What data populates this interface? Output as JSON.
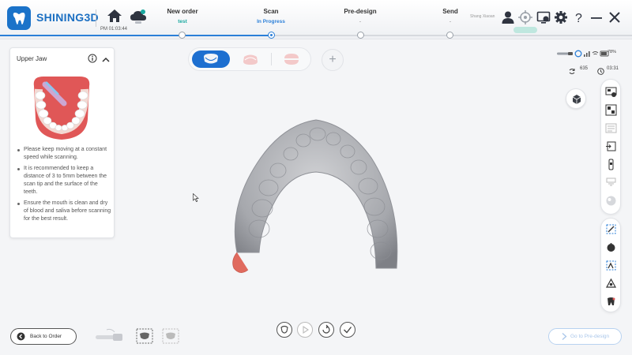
{
  "app": {
    "brand": "SHINING3D",
    "time": "PM 01:03:44",
    "user_name": "Shang Xiaoan",
    "accent": "#1d6fd0",
    "teal": "#1aa8a0"
  },
  "steps": [
    {
      "title": "New order",
      "sub": "test",
      "state": "done"
    },
    {
      "title": "Scan",
      "sub": "In Progress",
      "state": "active"
    },
    {
      "title": "Pre-design",
      "sub": "-",
      "state": "pending"
    },
    {
      "title": "Send",
      "sub": "-",
      "state": "pending"
    }
  ],
  "header_icons": [
    "home-icon",
    "cloud-icon",
    "user-icon",
    "target-icon",
    "screen-settings-icon",
    "gear-icon",
    "help-icon",
    "minimize-icon",
    "close-icon"
  ],
  "jaw_panel": {
    "title": "Upper Jaw",
    "tips": [
      "Please keep moving at a constant speed while scanning.",
      "It is recommended to keep a distance of 3 to 5mm between the scan tip and the surface of the teeth.",
      "Ensure the mouth is clean and dry of blood and saliva before scanning for the best result."
    ]
  },
  "jaw_selector": {
    "options": [
      "upper-jaw",
      "lower-jaw",
      "bite"
    ],
    "selected": "upper-jaw"
  },
  "status": {
    "battery": "78%",
    "count": "635",
    "duration": "03:31"
  },
  "right_toolbar_top": [
    "scan-mode-icon",
    "texture-icon",
    "filter-icon",
    "import-icon",
    "scanner-icon",
    "tip-icon",
    "color-icon"
  ],
  "right_toolbar_bottom": [
    "select-icon",
    "crop-icon",
    "lasso-icon",
    "measure-icon",
    "tooth-icon"
  ],
  "bottom": {
    "back_label": "Back to Order",
    "go_label": "Go to Pre-design",
    "actions": [
      "pause-icon",
      "play-icon",
      "undo-icon",
      "check-icon"
    ]
  }
}
